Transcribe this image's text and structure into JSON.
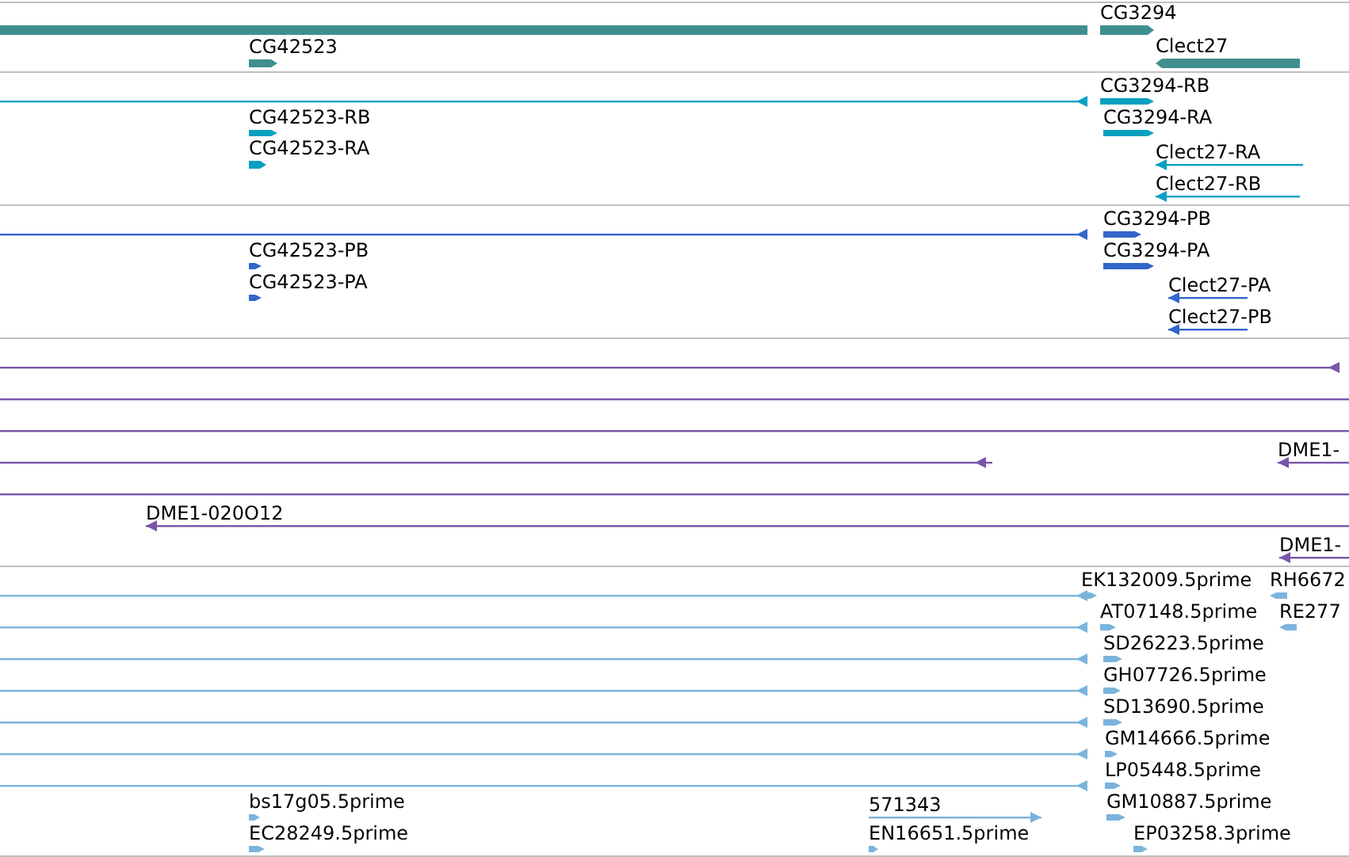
{
  "tracks": [
    {
      "color": "#3f8f8f",
      "features": [
        {
          "kind": "bar"
        },
        {
          "label": "CG3294",
          "kind": "bar",
          "reverse": false
        },
        {
          "label": "CG42523",
          "kind": "bar",
          "reverse": false
        },
        {
          "label": "Clect27",
          "kind": "bar",
          "reverse": true
        }
      ]
    },
    {
      "color": "#0aa0c0",
      "features": [
        {
          "kind": "line",
          "reverse": true
        },
        {
          "label": "CG3294-RB",
          "kind": "bar",
          "reverse": false
        },
        {
          "label": "CG42523-RB",
          "kind": "bar",
          "reverse": false
        },
        {
          "label": "CG3294-RA",
          "kind": "bar",
          "reverse": false
        },
        {
          "label": "CG42523-RA",
          "kind": "bar",
          "reverse": false
        },
        {
          "label": "Clect27-RA",
          "kind": "line",
          "reverse": true
        },
        {
          "label": "Clect27-RB",
          "kind": "line",
          "reverse": true
        }
      ]
    },
    {
      "color": "#3366cc",
      "features": [
        {
          "kind": "line",
          "reverse": true
        },
        {
          "label": "CG3294-PB",
          "kind": "bar",
          "reverse": false
        },
        {
          "label": "CG42523-PB",
          "kind": "bar",
          "reverse": false
        },
        {
          "label": "CG3294-PA",
          "kind": "bar",
          "reverse": false
        },
        {
          "label": "CG42523-PA",
          "kind": "bar",
          "reverse": false
        },
        {
          "label": "Clect27-PA",
          "kind": "line",
          "reverse": true
        },
        {
          "label": "Clect27-PB",
          "kind": "line",
          "reverse": true
        }
      ]
    },
    {
      "color": "#7a55aa",
      "features": [
        {
          "kind": "line",
          "reverse": true
        },
        {
          "kind": "line"
        },
        {
          "kind": "line"
        },
        {
          "kind": "line",
          "reverse": true
        },
        {
          "label": "DME1-",
          "kind": "line",
          "reverse": true
        },
        {
          "kind": "line"
        },
        {
          "label": "DME1-020O12",
          "kind": "line",
          "reverse": true
        },
        {
          "label": "DME1-",
          "kind": "line",
          "reverse": true
        }
      ]
    },
    {
      "color": "#7ab4dc",
      "features": [
        {
          "kind": "line",
          "reverse": true
        },
        {
          "label": "EK132009.5prime",
          "kind": "bar",
          "reverse": false
        },
        {
          "label": "RH6672",
          "kind": "bar",
          "reverse": true
        },
        {
          "kind": "line",
          "reverse": true
        },
        {
          "label": "AT07148.5prime",
          "kind": "bar",
          "reverse": false
        },
        {
          "label": "RE277",
          "kind": "bar",
          "reverse": true
        },
        {
          "kind": "line",
          "reverse": true
        },
        {
          "label": "SD26223.5prime",
          "kind": "bar",
          "reverse": false
        },
        {
          "kind": "line",
          "reverse": true
        },
        {
          "label": "GH07726.5prime",
          "kind": "bar",
          "reverse": false
        },
        {
          "kind": "line",
          "reverse": true
        },
        {
          "label": "SD13690.5prime",
          "kind": "bar",
          "reverse": false
        },
        {
          "kind": "line",
          "reverse": true
        },
        {
          "label": "GM14666.5prime",
          "kind": "bar",
          "reverse": false
        },
        {
          "kind": "line",
          "reverse": true
        },
        {
          "label": "LP05448.5prime",
          "kind": "bar",
          "reverse": false
        },
        {
          "label": "bs17g05.5prime",
          "kind": "bar",
          "reverse": false
        },
        {
          "label": "571343",
          "kind": "line",
          "reverse": false
        },
        {
          "label": "GM10887.5prime",
          "kind": "bar",
          "reverse": false
        },
        {
          "label": "EC28249.5prime",
          "kind": "bar",
          "reverse": false
        },
        {
          "label": "EN16651.5prime",
          "kind": "bar",
          "reverse": false
        },
        {
          "label": "EP03258.3prime",
          "kind": "bar",
          "reverse": false
        }
      ]
    }
  ]
}
